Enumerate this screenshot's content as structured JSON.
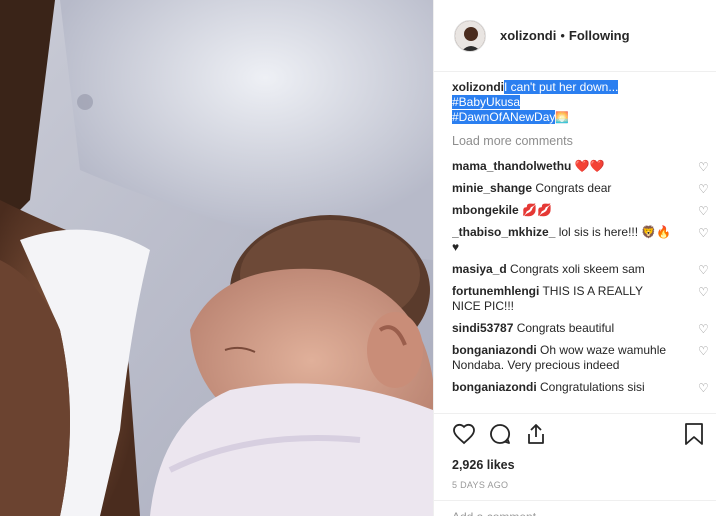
{
  "post": {
    "username": "xolizondi",
    "separator": "•",
    "follow_status": "Following",
    "caption_user": "xolizondi",
    "caption_lines": [
      "I can't put her down...",
      "#BabyUkusa",
      "#DawnOfANewDay"
    ],
    "caption_emoji": "🌅",
    "load_more": "Load more comments",
    "likes": "2,926 likes",
    "timestamp": "5 DAYS AGO",
    "add_comment_placeholder": "Add a comment..."
  },
  "comments": [
    {
      "user": "mama_thandolwethu",
      "text": "❤️❤️"
    },
    {
      "user": "minie_shange",
      "text": "Congrats dear"
    },
    {
      "user": "mbongekile",
      "text": "💋💋"
    },
    {
      "user": "_thabiso_mkhize_",
      "text": "lol sis is here!!! 🦁🔥♥"
    },
    {
      "user": "masiya_d",
      "text": "Congrats xoli skeem sam"
    },
    {
      "user": "fortunemhlengi",
      "text": "THIS IS A REALLY NICE PIC!!!"
    },
    {
      "user": "sindi53787",
      "text": "Congrats beautiful"
    },
    {
      "user": "bonganiazondi",
      "text": "Oh wow waze wamuhle Nondaba. Very precious indeed"
    },
    {
      "user": "bonganiazondi",
      "text": "Congratulations sisi"
    }
  ],
  "icons": {
    "like": "heart-icon",
    "comment": "comment-bubble-icon",
    "share": "share-icon",
    "save": "bookmark-icon",
    "comment_like": "small-heart-icon"
  },
  "colors": {
    "highlight": "#2b7ff0",
    "muted": "#8e8e8e",
    "text": "#262626"
  }
}
